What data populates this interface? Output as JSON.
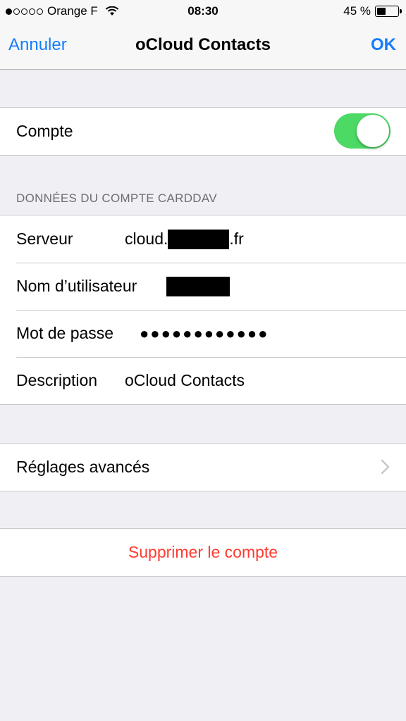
{
  "status_bar": {
    "carrier": "Orange F",
    "time": "08:30",
    "battery": "45 %",
    "battery_level": 0.45,
    "signal_bars": 1
  },
  "nav": {
    "cancel": "Annuler",
    "title": "oCloud Contacts",
    "ok": "OK"
  },
  "account": {
    "label": "Compte",
    "enabled": true
  },
  "section_header": "DONNÉES DU COMPTE CARDDAV",
  "fields": {
    "server_label": "Serveur",
    "server_prefix": "cloud.",
    "server_suffix": ".fr",
    "username_label": "Nom d’utilisateur",
    "password_label": "Mot de passe",
    "password_value": "●●●●●●●●●●●●",
    "description_label": "Description",
    "description_value": "oCloud Contacts"
  },
  "advanced": {
    "label": "Réglages avancés"
  },
  "delete": {
    "label": "Supprimer le compte"
  },
  "colors": {
    "accent": "#147efb",
    "toggle_on": "#4cd964",
    "destructive": "#ff3b30",
    "background": "#efeff4"
  },
  "icons": [
    "wifi-icon",
    "battery-icon",
    "chevron-right-icon"
  ]
}
